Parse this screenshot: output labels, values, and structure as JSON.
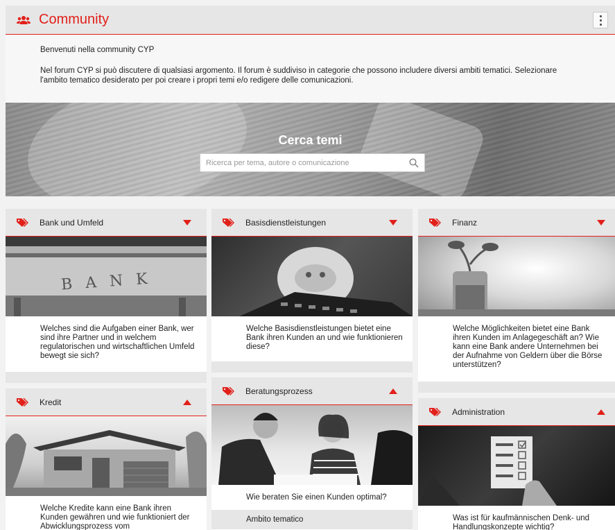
{
  "header": {
    "title": "Community"
  },
  "intro": {
    "welcome": "Benvenuti nella community CYP",
    "text": "Nel forum CYP si può discutere di qualsiasi argomento. Il forum è suddiviso in categorie che possono includere diversi ambiti tematici. Selezionare l'ambito tematico desiderato per poi creare i propri temi e/o redigere delle comunicazioni."
  },
  "hero": {
    "title": "Cerca temi",
    "search_placeholder": "Ricerca per tema, autore o comunicazione"
  },
  "cards": [
    {
      "name": "Bank und Umfeld",
      "state": "collapsed",
      "image": "bank-building-photo",
      "description": "Welches sind die Aufgaben einer Bank, wer sind ihre Partner und in welchem regulatorischen und wirtschaftlichen Umfeld bewegt sie sich?"
    },
    {
      "name": "Basisdienstleistungen",
      "state": "collapsed",
      "image": "piggy-bank-photo",
      "description": "Welche Basisdienstleistungen bietet eine Bank ihren Kunden an und wie funktionieren diese?"
    },
    {
      "name": "Finanz",
      "state": "collapsed",
      "image": "coin-jar-plant-photo",
      "description": "Welche Möglichkeiten bietet eine Bank ihren Kunden im Anlagegeschäft an? Wie kann eine Bank andere Unternehmen bei der Aufnahme von Geldern über die Börse unterstützen?"
    },
    {
      "name": "Kredit",
      "state": "expanded",
      "image": "house-photo",
      "description": "Welche Kredite kann eine Bank ihren Kunden gewähren und wie funktioniert der Abwicklungsprozess vom"
    },
    {
      "name": "Beratungsprozess",
      "state": "expanded",
      "image": "advisor-meeting-photo",
      "description": "Wie beraten Sie einen Kunden optimal?",
      "sub_label": "Ambito tematico"
    },
    {
      "name": "Administration",
      "state": "expanded",
      "image": "checklist-hand-photo",
      "description": "Was ist für kaufmännischen Denk- und Handlungskonzepte wichtig?"
    }
  ],
  "colors": {
    "accent": "#e2201a",
    "header_bg": "#e6e6e6",
    "page_bg": "#f2f2f2"
  }
}
